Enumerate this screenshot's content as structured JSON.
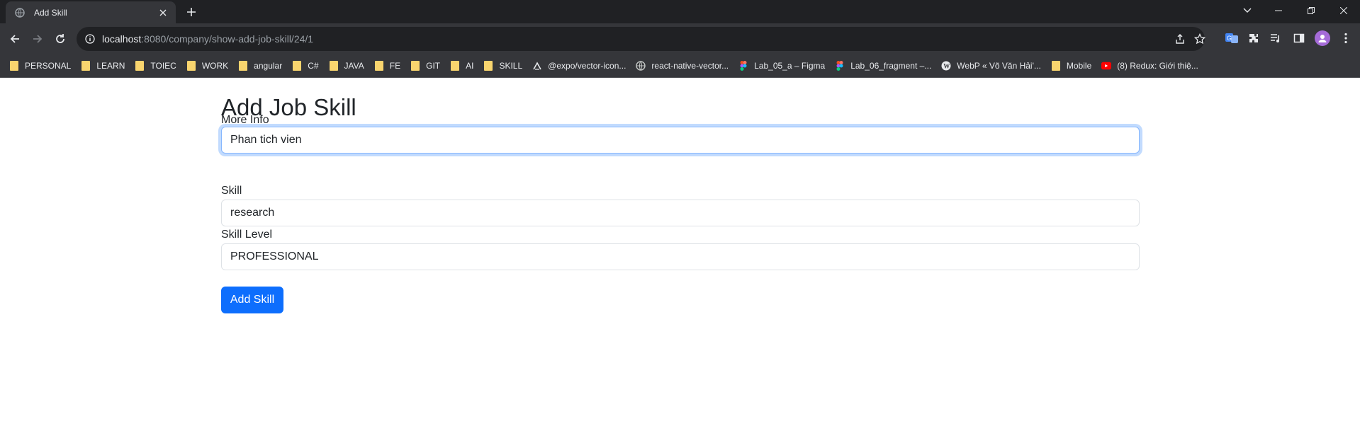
{
  "browser": {
    "tab": {
      "title": "Add Skill"
    },
    "address": {
      "host": "localhost",
      "rest": ":8080/company/show-add-job-skill/24/1"
    },
    "bookmarks": [
      {
        "label": "PERSONAL",
        "icon": "folder-icon"
      },
      {
        "label": "LEARN",
        "icon": "folder-icon"
      },
      {
        "label": "TOIEC",
        "icon": "folder-icon"
      },
      {
        "label": "WORK",
        "icon": "folder-icon"
      },
      {
        "label": "angular",
        "icon": "folder-icon"
      },
      {
        "label": "C#",
        "icon": "folder-icon"
      },
      {
        "label": "JAVA",
        "icon": "folder-icon"
      },
      {
        "label": "FE",
        "icon": "folder-icon"
      },
      {
        "label": "GIT",
        "icon": "folder-icon"
      },
      {
        "label": "AI",
        "icon": "folder-icon"
      },
      {
        "label": "SKILL",
        "icon": "folder-icon"
      },
      {
        "label": "@expo/vector-icon...",
        "icon": "expo-icon"
      },
      {
        "label": "react-native-vector...",
        "icon": "globe-icon"
      },
      {
        "label": "Lab_05_a – Figma",
        "icon": "figma-icon"
      },
      {
        "label": "Lab_06_fragment –...",
        "icon": "figma-icon"
      },
      {
        "label": "WebP « Võ Văn Hải'...",
        "icon": "wordpress-icon"
      },
      {
        "label": "Mobile",
        "icon": "folder-icon"
      },
      {
        "label": "(8) Redux: Giới thiệ...",
        "icon": "youtube-icon"
      }
    ]
  },
  "form": {
    "title": "Add Job Skill",
    "more_info": {
      "label": "More Info",
      "value": "Phan tich vien"
    },
    "skill": {
      "label": "Skill",
      "value": "research"
    },
    "skill_level": {
      "label": "Skill Level",
      "value": "PROFESSIONAL"
    },
    "submit_label": "Add Skill"
  },
  "colors": {
    "primary": "#0d6efd",
    "chrome_dark": "#202124",
    "chrome_toolbar": "#35363a"
  }
}
